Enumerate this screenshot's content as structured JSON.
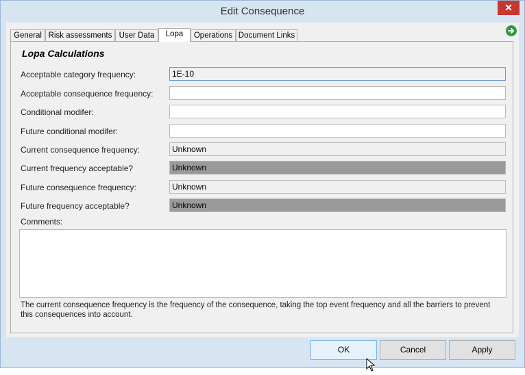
{
  "window": {
    "title": "Edit Consequence",
    "close_label": "✕"
  },
  "tabs": [
    {
      "label": "General"
    },
    {
      "label": "Risk assessments"
    },
    {
      "label": "User Data"
    },
    {
      "label": "Lopa"
    },
    {
      "label": "Operations"
    },
    {
      "label": "Document Links"
    }
  ],
  "active_tab": "Lopa",
  "lopa": {
    "section_title": "Lopa Calculations",
    "fields": {
      "acceptable_category_frequency": {
        "label": "Acceptable category frequency:",
        "value": "1E-10"
      },
      "acceptable_consequence_frequency": {
        "label": "Acceptable consequence frequency:",
        "value": ""
      },
      "conditional_modifier": {
        "label": "Conditional modifer:",
        "value": ""
      },
      "future_conditional_modifier": {
        "label": "Future conditional modifer:",
        "value": ""
      },
      "current_consequence_frequency": {
        "label": "Current consequence frequency:",
        "value": "Unknown"
      },
      "current_frequency_acceptable": {
        "label": "Current frequency acceptable?",
        "value": "Unknown"
      },
      "future_consequence_frequency": {
        "label": "Future consequence frequency:",
        "value": "Unknown"
      },
      "future_frequency_acceptable": {
        "label": "Future frequency acceptable?",
        "value": "Unknown"
      }
    },
    "comments_label": "Comments:",
    "comments_value": "",
    "info_text": "The current consequence frequency is the frequency of the consequence, taking the top event frequency and all the barriers to prevent this consequences into account."
  },
  "buttons": {
    "ok": "OK",
    "cancel": "Cancel",
    "apply": "Apply"
  },
  "colors": {
    "title_bar": "#d7e4f2",
    "close_button": "#c7372f",
    "status_unknown": "#9a9a9a",
    "go_icon": "#2e9a3c"
  },
  "icons": {
    "close": "close-icon",
    "navigate": "arrow-right-circle-icon",
    "cursor": "mouse-pointer-icon"
  }
}
